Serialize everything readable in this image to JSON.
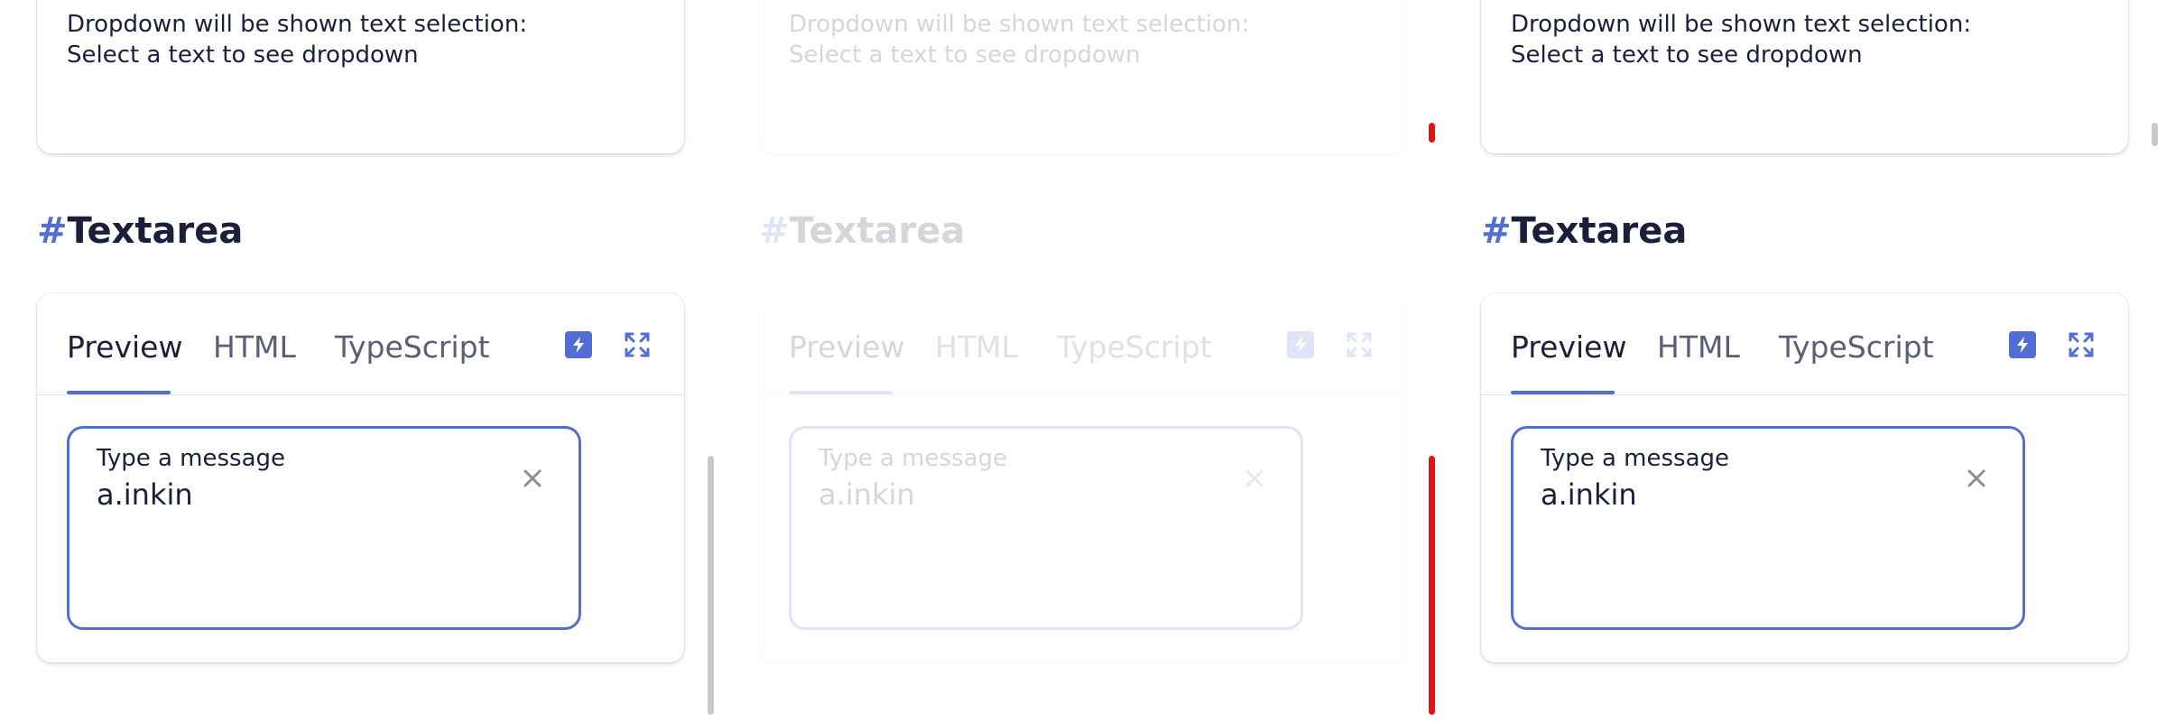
{
  "sections": [
    {
      "top_card": {
        "line1": "Dropdown will be shown text selection:",
        "line2": "Select a text to see dropdown"
      },
      "heading": {
        "hash": "#",
        "title": "Textarea"
      },
      "tabs": [
        {
          "label": "Preview"
        },
        {
          "label": "HTML"
        },
        {
          "label": "TypeScript"
        }
      ],
      "tools": {
        "bolt_icon": "lightning-bolt",
        "expand_icon": "expand-arrows"
      },
      "textarea": {
        "label": "Type a message",
        "value": "a.inkin",
        "clear_icon": "close-x"
      }
    },
    {
      "top_card": {
        "line1": "Dropdown will be shown text selection:",
        "line2": "Select a text to see dropdown"
      },
      "heading": {
        "hash": "#",
        "title": "Textarea"
      },
      "tabs": [
        {
          "label": "Preview"
        },
        {
          "label": "HTML"
        },
        {
          "label": "TypeScript"
        }
      ],
      "tools": {
        "bolt_icon": "lightning-bolt",
        "expand_icon": "expand-arrows"
      },
      "textarea": {
        "label": "Type a message",
        "value": "a.inkin",
        "clear_icon": "close-x"
      }
    },
    {
      "top_card": {
        "line1": "Dropdown will be shown text selection:",
        "line2": "Select a text to see dropdown"
      },
      "heading": {
        "hash": "#",
        "title": "Textarea"
      },
      "tabs": [
        {
          "label": "Preview"
        },
        {
          "label": "HTML"
        },
        {
          "label": "TypeScript"
        }
      ],
      "tools": {
        "bolt_icon": "lightning-bolt",
        "expand_icon": "expand-arrows"
      },
      "textarea": {
        "label": "Type a message",
        "value": "a.inkin",
        "clear_icon": "close-x"
      }
    }
  ],
  "colors": {
    "accent": "#526ed3",
    "text": "#1b1f3b",
    "tab_inactive": "#5a5e76",
    "scrollbar_gray": "#c8c9cf",
    "scrollbar_red": "#e8140c"
  }
}
